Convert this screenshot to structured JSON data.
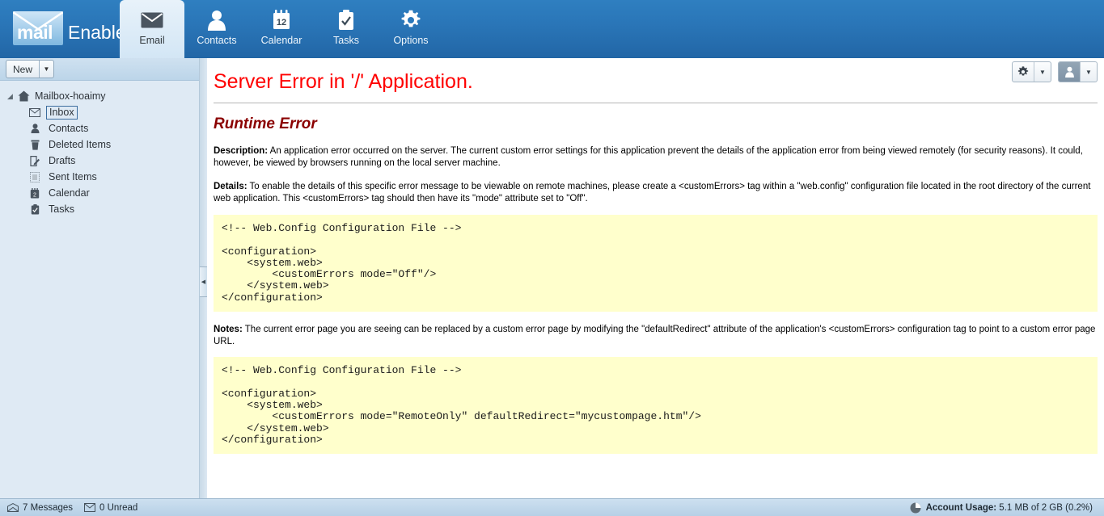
{
  "app": {
    "brand_mail": "mail",
    "brand_enable": "Enable",
    "accent_blue": "#2a78bb",
    "error_red": "#ff0000",
    "code_bg": "#ffffcc"
  },
  "tabs": [
    {
      "label": "Email",
      "icon": "envelope-icon",
      "active": true
    },
    {
      "label": "Contacts",
      "icon": "person-icon",
      "active": false
    },
    {
      "label": "Calendar",
      "icon": "calendar-icon",
      "active": false
    },
    {
      "label": "Tasks",
      "icon": "clipboard-check-icon",
      "active": false
    },
    {
      "label": "Options",
      "icon": "gear-icon",
      "active": false
    }
  ],
  "header_buttons": {
    "settings_icon": "gear-icon",
    "account_icon": "person-icon",
    "dropdown_caret": "▼"
  },
  "sidebar": {
    "new_button": {
      "label": "New",
      "caret": "▼"
    },
    "root": {
      "label": "Mailbox-hoaimy",
      "icon": "home-icon",
      "twisty": "◢"
    },
    "items": [
      {
        "label": "Inbox",
        "icon": "envelope-icon",
        "selected": true
      },
      {
        "label": "Contacts",
        "icon": "person-icon",
        "selected": false
      },
      {
        "label": "Deleted Items",
        "icon": "trash-icon",
        "selected": false
      },
      {
        "label": "Drafts",
        "icon": "draft-pencil-icon",
        "selected": false
      },
      {
        "label": "Sent Items",
        "icon": "sent-items-icon",
        "selected": false
      },
      {
        "label": "Calendar",
        "icon": "calendar-icon",
        "selected": false
      },
      {
        "label": "Tasks",
        "icon": "clipboard-check-icon",
        "selected": false
      }
    ],
    "splitter_handle": "◀"
  },
  "main": {
    "title": "Server Error in '/' Application.",
    "subtitle": "Runtime Error",
    "description_label": "Description:",
    "description_text": " An application error occurred on the server. The current custom error settings for this application prevent the details of the application error from being viewed remotely (for security reasons). It could, however, be viewed by browsers running on the local server machine.",
    "details_label": "Details:",
    "details_text": " To enable the details of this specific error message to be viewable on remote machines, please create a <customErrors> tag within a \"web.config\" configuration file located in the root directory of the current web application. This <customErrors> tag should then have its \"mode\" attribute set to \"Off\".",
    "code_block_1": "<!-- Web.Config Configuration File -->\n\n<configuration>\n    <system.web>\n        <customErrors mode=\"Off\"/>\n    </system.web>\n</configuration>",
    "notes_label": "Notes:",
    "notes_text": " The current error page you are seeing can be replaced by a custom error page by modifying the \"defaultRedirect\" attribute of the application's <customErrors> configuration tag to point to a custom error page URL.",
    "code_block_2": "<!-- Web.Config Configuration File -->\n\n<configuration>\n    <system.web>\n        <customErrors mode=\"RemoteOnly\" defaultRedirect=\"mycustompage.htm\"/>\n    </system.web>\n</configuration>"
  },
  "statusbar": {
    "messages": "7 Messages",
    "messages_icon": "open-envelope-icon",
    "unread": "0 Unread",
    "unread_icon": "envelope-icon",
    "usage_icon": "pie-chart-icon",
    "usage_label": "Account Usage:",
    "usage_value": " 5.1 MB of 2 GB (0.2%)"
  }
}
